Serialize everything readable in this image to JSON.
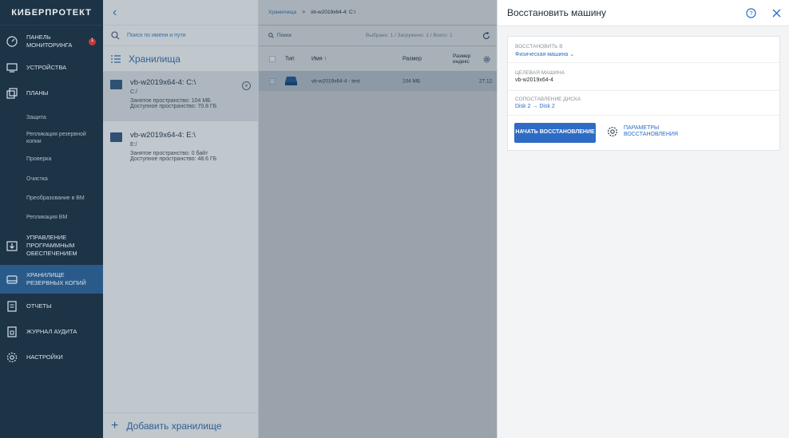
{
  "nav": {
    "brand": "КИБЕРПРОТЕКТ",
    "items": [
      {
        "label": "ПАНЕЛЬ МОНИТОРИНГА",
        "badge": "1"
      },
      {
        "label": "УСТРОЙСТВА"
      },
      {
        "label": "ПЛАНЫ"
      },
      {
        "label": "УПРАВЛЕНИЕ ПРОГРАММНЫМ ОБЕСПЕЧЕНИЕМ"
      },
      {
        "label": "ХРАНИЛИЩЕ РЕЗЕРВНЫХ КОПИЙ"
      },
      {
        "label": "ОТЧЕТЫ"
      },
      {
        "label": "ЖУРНАЛ АУДИТА"
      },
      {
        "label": "НАСТРОЙКИ"
      }
    ],
    "plans_sub": [
      "Защита",
      "Репликация резервной копии",
      "Проверка",
      "Очистка",
      "Преобразование в ВМ",
      "Репликация ВМ"
    ]
  },
  "vaults": {
    "back_glyph": "‹",
    "search_placeholder": "Поиск по имени и пути",
    "title": "Хранилища",
    "items": [
      {
        "name": "vb-w2019x64-4: C:\\",
        "path": "C:/",
        "used": "Занятое пространство: 104 МБ",
        "free": "Доступное пространство: 70.8 ГБ"
      },
      {
        "name": "vb-w2019x64-4: E:\\",
        "path": "E:/",
        "used": "Занятое пространство: 0 байт",
        "free": "Доступное пространство: 48.6 ГБ"
      }
    ],
    "add_label": "Добавить хранилище"
  },
  "main": {
    "breadcrumb_root": "Хранилища",
    "breadcrumb_sep": ">",
    "breadcrumb_current": "vb-w2019x64-4: C:\\",
    "search_label": "Поиск",
    "selection_info": "Выбрано: 1 / Загружено: 1 / Всего: 1",
    "columns": {
      "type": "Тип",
      "name": "Имя ↑",
      "size": "Размер",
      "index_size": "Размер индекс"
    },
    "rows": [
      {
        "name": "vb-w2019x64-4 - test",
        "size": "104 МБ",
        "date": "27.12."
      }
    ]
  },
  "panel": {
    "title": "Восстановить машину",
    "restore_to_label": "ВОССТАНОВИТЬ В",
    "restore_to_value": "Физическая машина",
    "target_label": "ЦЕЛЕВАЯ МАШИНА",
    "target_value": "vb-w2019x64-4",
    "mapping_label": "СОПОСТАВЛЕНИЕ ДИСКА",
    "mapping_value": "Disk 2 → Disk 2",
    "start_button": "НАЧАТЬ ВОССТАНОВЛЕНИЕ",
    "params_button": "ПАРАМЕТРЫ ВОССТАНОВЛЕНИЯ"
  },
  "colors": {
    "nav_bg": "#1d3346",
    "accent": "#2e6bc4",
    "active_nav": "#2a5a8a",
    "badge": "#c73a3a"
  }
}
